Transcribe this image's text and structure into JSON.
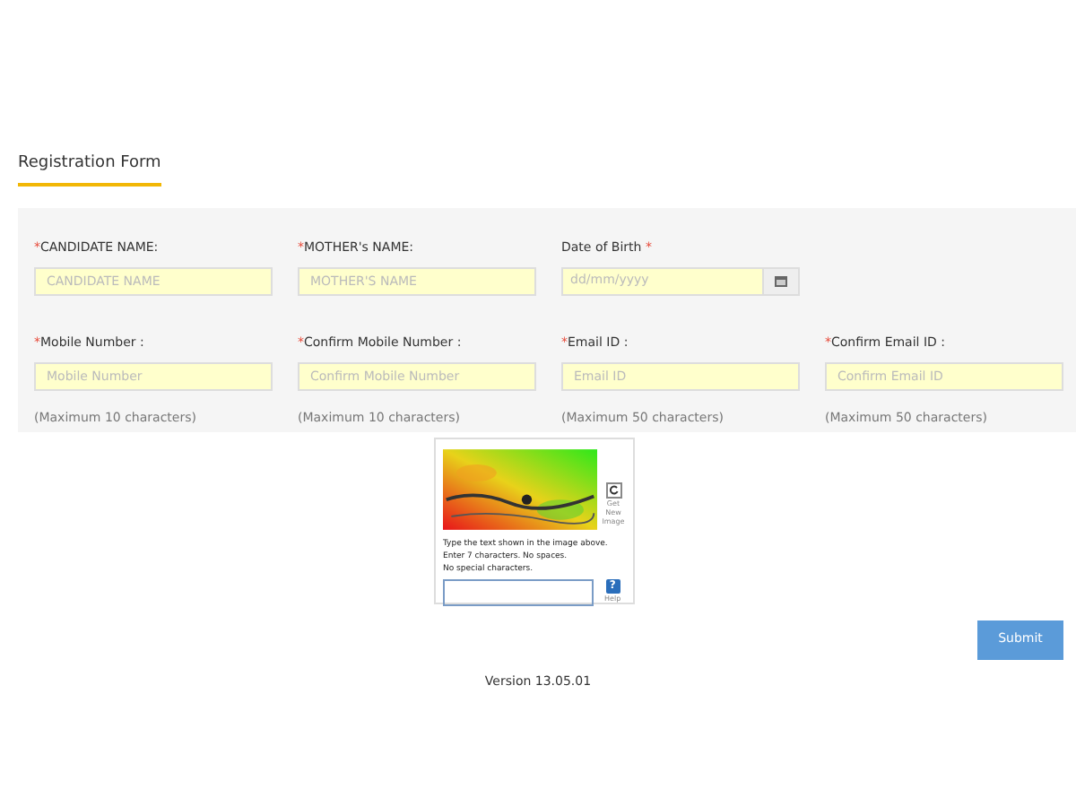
{
  "form_title": "Registration Form",
  "rows": [
    [
      {
        "kind": "text",
        "label": "CANDIDATE NAME:",
        "marker": "*",
        "placeholder": "CANDIDATE NAME"
      },
      {
        "kind": "text",
        "label": "MOTHER's NAME:",
        "marker": "*",
        "placeholder": "MOTHER'S NAME"
      },
      {
        "kind": "date",
        "label": "Date of Birth",
        "marker": "*",
        "placeholder": "dd/mm/yyyy"
      }
    ],
    [
      {
        "kind": "text",
        "label": "Mobile Number :",
        "marker": "*",
        "placeholder": "Mobile Number",
        "hint": "(Maximum 10 characters)"
      },
      {
        "kind": "text",
        "label": "Confirm Mobile Number :",
        "marker": "*",
        "placeholder": "Confirm Mobile Number",
        "hint": "(Maximum 10 characters)"
      },
      {
        "kind": "text",
        "label": "Email ID :",
        "marker": "*",
        "placeholder": "Email ID",
        "hint": "(Maximum 50 characters)"
      },
      {
        "kind": "text",
        "label": "Confirm Email ID :",
        "marker": "*",
        "placeholder": "Confirm Email ID",
        "hint": "(Maximum 50 characters)"
      }
    ]
  ],
  "captcha": {
    "new_image": "Get New Image",
    "instructions": [
      "Type the text shown in the image above.",
      "Enter 7 characters. No spaces.",
      "No special characters."
    ],
    "help_icon": "?",
    "help": "Help"
  },
  "submit": "Submit",
  "version": "Version 13.05.01"
}
